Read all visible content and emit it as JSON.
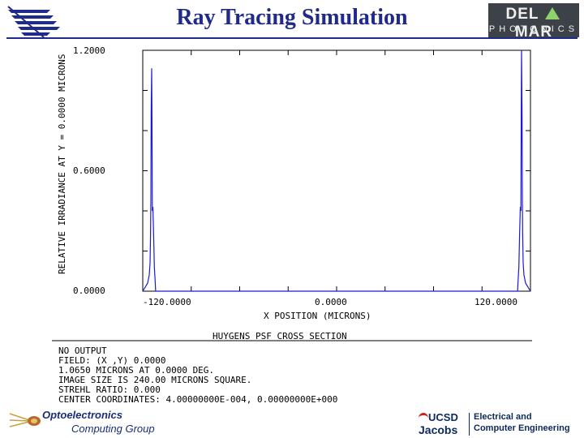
{
  "header": {
    "title": "Ray Tracing Simulation",
    "brand_line1_left": "DEL",
    "brand_line1_right": "MAR",
    "brand_line2": "PHOTONICS"
  },
  "chart_data": {
    "type": "line",
    "title": "HUYGENS PSF CROSS SECTION",
    "xlabel": "X POSITION (MICRONS)",
    "ylabel": "RELATIVE IRRADIANCE AT Y = 0.0000 MICRONS",
    "xlim": [
      -120.0,
      120.0
    ],
    "ylim": [
      0.0,
      1.2
    ],
    "x_ticks": [
      "-120.0000",
      "0.0000",
      "120.0000"
    ],
    "y_ticks": [
      "0.0000",
      "0.6000",
      "1.2000"
    ],
    "grid": false,
    "series": [
      {
        "x": [
          -120.0,
          -117.0,
          -116.0,
          -115.5,
          -115.2,
          -115.0,
          -114.8,
          -114.5,
          -114.3,
          -114.1,
          -113.7,
          -113.3,
          -112.8,
          -112.3,
          -112.0,
          112.0,
          112.3,
          112.8,
          113.3,
          113.7,
          114.1,
          114.3,
          114.5,
          114.8,
          115.0,
          115.2,
          115.5,
          116.0,
          117.0,
          120.0
        ],
        "y": [
          0.0,
          0.04,
          0.08,
          0.14,
          0.28,
          0.45,
          0.9,
          1.11,
          0.85,
          0.4,
          0.42,
          0.3,
          0.12,
          0.05,
          0.0,
          0.0,
          0.05,
          0.12,
          0.3,
          0.42,
          0.4,
          0.85,
          1.2,
          0.9,
          0.45,
          0.28,
          0.14,
          0.08,
          0.04,
          0.0
        ]
      }
    ],
    "notes": [
      "NO OUTPUT",
      "FIELD: (X ,Y) 0.0000",
      "1.0650 MICRONS AT 0.0000 DEG.",
      "IMAGE SIZE IS 240.00 MICRONS SQUARE.",
      "STREHL RATIO: 0.000",
      "CENTER COORDINATES: 4.00000000E-004, 0.00000000E+000"
    ]
  },
  "footer": {
    "org_line1": "Optoelectronics",
    "org_line2": "Computing Group",
    "ucsd_line1": "UCSD",
    "ucsd_line2": "Jacobs",
    "dept_line1": "Electrical and",
    "dept_line2": "Computer Engineering"
  }
}
